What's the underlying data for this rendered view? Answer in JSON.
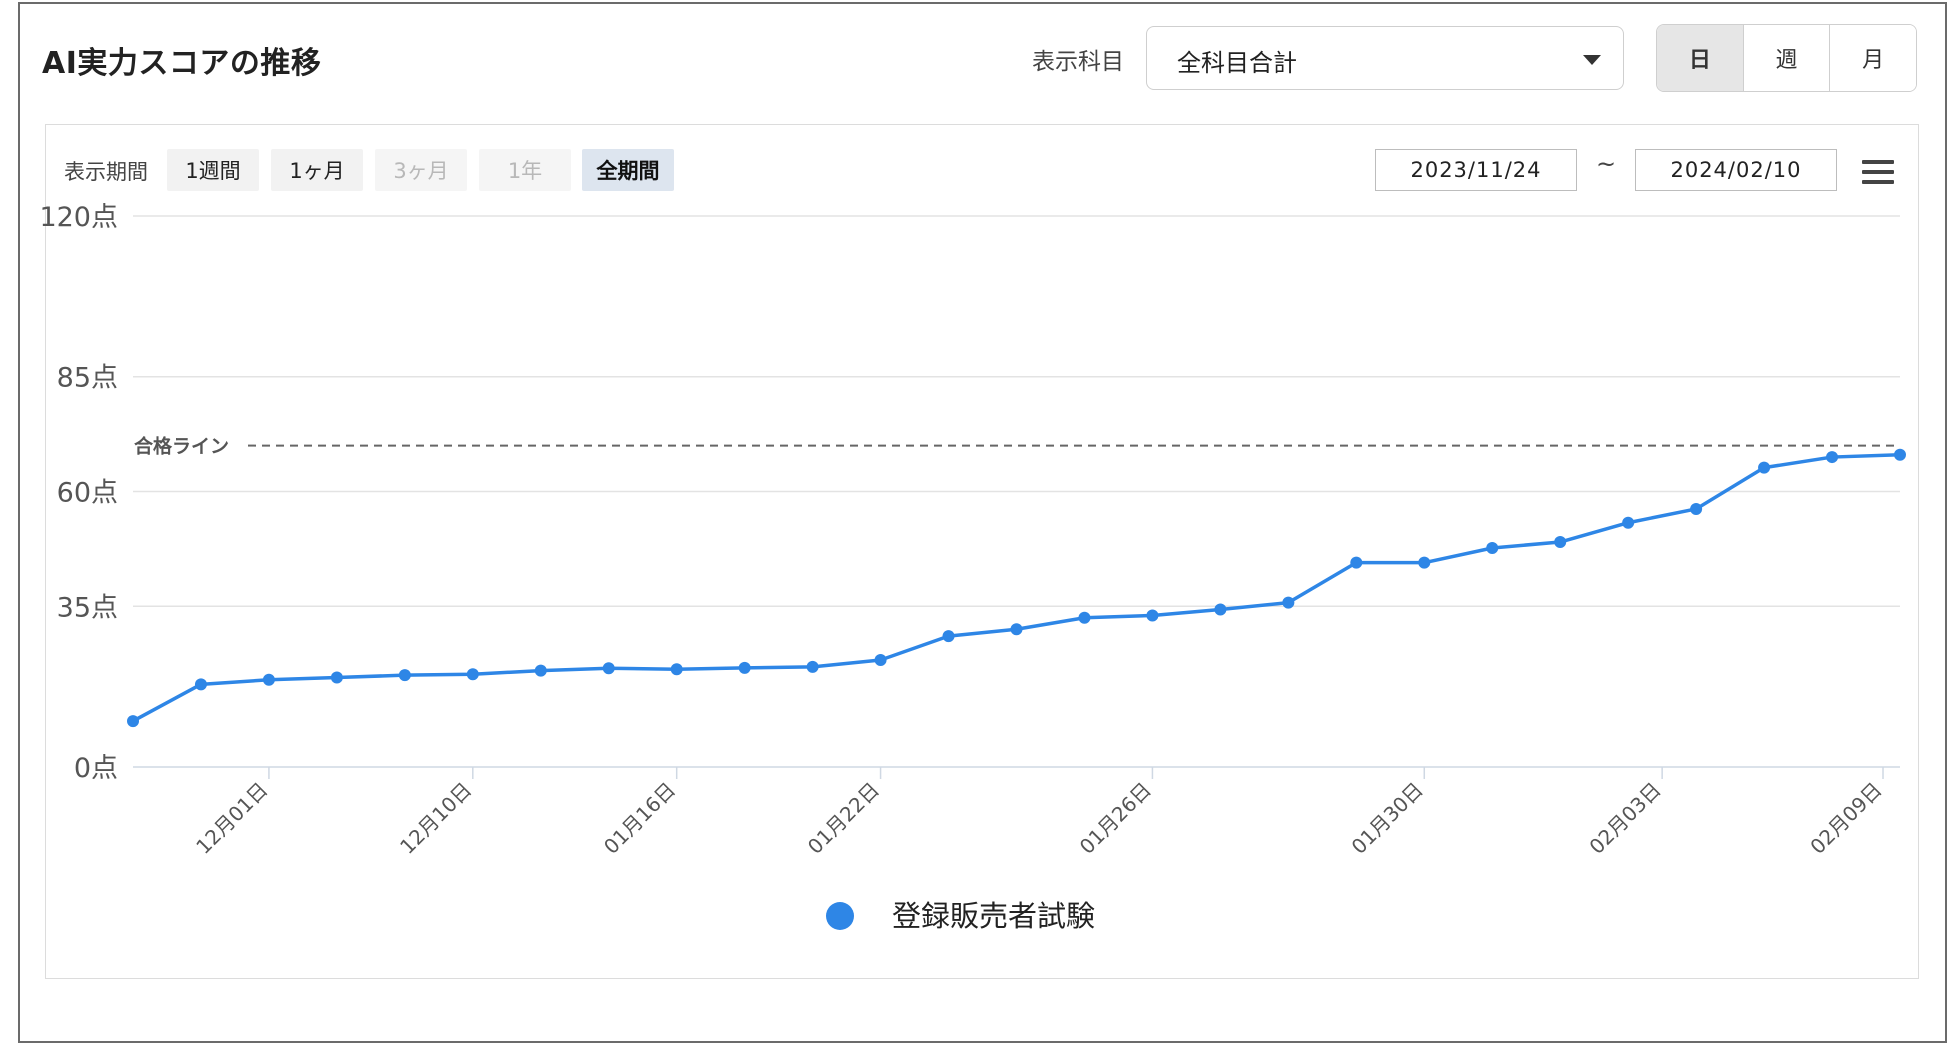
{
  "header": {
    "title": "AI実力スコアの推移",
    "subject_label": "表示科目",
    "subject_value": "全科目合計",
    "granularity": [
      {
        "label": "日",
        "active": true
      },
      {
        "label": "週",
        "active": false
      },
      {
        "label": "月",
        "active": false
      }
    ]
  },
  "toolbar": {
    "period_label": "表示期間",
    "periods": [
      {
        "label": "1週間",
        "state": "normal"
      },
      {
        "label": "1ヶ月",
        "state": "normal"
      },
      {
        "label": "3ヶ月",
        "state": "disabled"
      },
      {
        "label": "1年",
        "state": "disabled"
      },
      {
        "label": "全期間",
        "state": "active"
      }
    ],
    "date_from": "2023/11/24",
    "date_tilde": "~",
    "date_to": "2024/02/10"
  },
  "chart_data": {
    "type": "line",
    "series": [
      {
        "name": "登録販売者試験",
        "color": "#2e86e6",
        "values": [
          10,
          18,
          19,
          19.5,
          20,
          20.2,
          21,
          21.5,
          21.3,
          21.6,
          21.8,
          23.3,
          28.5,
          30,
          32.5,
          33,
          34.3,
          35.8,
          44.5,
          44.5,
          47.7,
          49,
          53.2,
          56.2,
          65.2,
          67.5,
          68
        ]
      }
    ],
    "y_ticks": [
      {
        "value": 0,
        "label": "0点"
      },
      {
        "value": 35,
        "label": "35点"
      },
      {
        "value": 60,
        "label": "60点"
      },
      {
        "value": 85,
        "label": "85点"
      },
      {
        "value": 120,
        "label": "120点"
      }
    ],
    "x_ticks": [
      {
        "index": 2,
        "label": "12月01日"
      },
      {
        "index": 5,
        "label": "12月10日"
      },
      {
        "index": 8,
        "label": "01月16日"
      },
      {
        "index": 11,
        "label": "01月22日"
      },
      {
        "index": 15,
        "label": "01月26日"
      },
      {
        "index": 19,
        "label": "01月30日"
      },
      {
        "index": 22.5,
        "label": "02月03日"
      },
      {
        "index": 25.75,
        "label": "02月09日"
      }
    ],
    "reference_line": {
      "value": 70,
      "label": "合格ライン"
    },
    "legend": {
      "position": "bottom"
    },
    "grid": true
  }
}
